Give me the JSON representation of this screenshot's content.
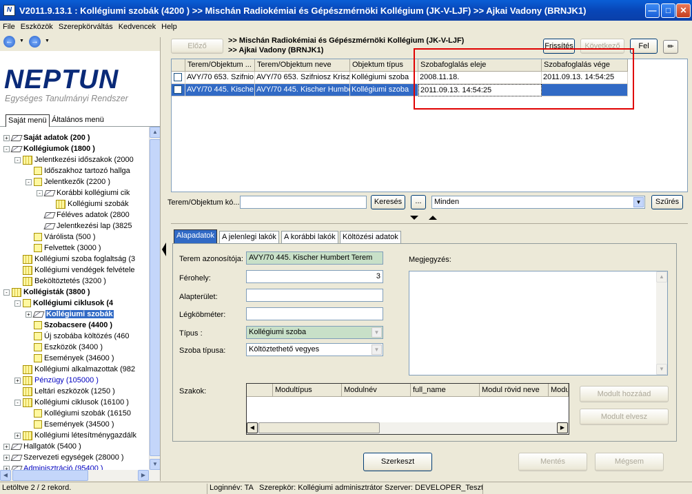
{
  "window": {
    "title": "V2011.9.13.1 : Kollégiumi szobák (4200  )  >> Mischán Radiokémiai és Gépészmérnöki Kollégium (JK-V-LJF) >> Ajkai Vadony (BRNJK1)",
    "app_icon": "N"
  },
  "menu": [
    "File",
    "Eszközök",
    "Szerepkörváltás",
    "Kedvencek",
    "Help"
  ],
  "logo": {
    "name": "NEPTUN",
    "subtitle": "Egységes Tanulmányi Rendszer"
  },
  "left_tabs": [
    "Saját menü",
    "Általános menü"
  ],
  "tree": [
    {
      "label": "Saját adatok (200  )",
      "icon": "diamond",
      "expander": "+",
      "bold": true
    },
    {
      "label": "Kollégiumok (1800  )",
      "icon": "diamond",
      "expander": "-",
      "bold": true
    },
    {
      "label": "Jelentkezési időszakok (2000",
      "icon": "multi",
      "expander": "-"
    },
    {
      "label": "Időszakhoz tartozó hallga",
      "icon": "folder"
    },
    {
      "label": "Jelentkezők (2200  )",
      "icon": "folder",
      "expander": "-"
    },
    {
      "label": "Korábbi kollégiumi cik",
      "icon": "diamond",
      "expander": "-"
    },
    {
      "label": "Kollégiumi szobák",
      "icon": "multi"
    },
    {
      "label": "Féléves adatok (2800",
      "icon": "diamond"
    },
    {
      "label": "Jelentkezési lap (3825",
      "icon": "diamond"
    },
    {
      "label": "Várólista (500  )",
      "icon": "folder"
    },
    {
      "label": "Felvettek (3000  )",
      "icon": "folder"
    },
    {
      "label": "Kollégiumi szoba foglaltság (3",
      "icon": "multi"
    },
    {
      "label": "Kollégiumi vendégek felvétele",
      "icon": "multi"
    },
    {
      "label": "Beköltöztetés (3200  )",
      "icon": "multi"
    },
    {
      "label": "Kollégisták (3800  )",
      "icon": "multi",
      "expander": "-",
      "bold": true
    },
    {
      "label": "Kollégiumi ciklusok (4",
      "icon": "folder",
      "expander": "-",
      "bold": true
    },
    {
      "label": "Kollégiumi szobák",
      "icon": "diamond",
      "expander": "+",
      "selected": true
    },
    {
      "label": "Szobacsere (4400  )",
      "icon": "folder",
      "bold": true
    },
    {
      "label": "Új szobába költözés (460",
      "icon": "folder"
    },
    {
      "label": "Eszközök (3400  )",
      "icon": "folder"
    },
    {
      "label": "Események (34600  )",
      "icon": "folder"
    },
    {
      "label": "Kollégiumi alkalmazottak (982",
      "icon": "multi"
    },
    {
      "label": "Pénzügy (105000  )",
      "icon": "multi",
      "expander": "+",
      "blue": true
    },
    {
      "label": "Leltári eszközök (1250  )",
      "icon": "multi"
    },
    {
      "label": "Kollégiumi ciklusok (16100  )",
      "icon": "multi",
      "expander": "-"
    },
    {
      "label": "Kollégiumi szobák (16150",
      "icon": "folder"
    },
    {
      "label": "Események (34500  )",
      "icon": "folder"
    },
    {
      "label": "Kollégiumi létesítménygazdálk",
      "icon": "multi",
      "expander": "+"
    },
    {
      "label": "Hallgatók (5400  )",
      "icon": "diamond",
      "expander": "+"
    },
    {
      "label": "Szervezeti egységek (28000  )",
      "icon": "diamond",
      "expander": "+"
    },
    {
      "label": "Adminisztráció (95400  )",
      "icon": "diamond",
      "expander": "+",
      "blue": true
    }
  ],
  "top": {
    "prev_button": "Előző",
    "crumb1": ">> Mischán Radiokémiai és Gépészmérnöki Kollégium (JK-V-LJF)",
    "crumb2": ">> Ajkai Vadony (BRNJK1)",
    "refresh_button": "Frissítés",
    "next_button": "Következő",
    "up_button": "Fel",
    "columns": [
      "Terem/Objektum ...",
      "Terem/Objektum neve",
      "Objektum típus",
      "Szobafoglalás eleje",
      "Szobafoglalás vége"
    ],
    "rows": [
      [
        "AVY/70 653. Szifnio",
        "AVY/70 653. Szifniosz Kriszti",
        "Kollégiumi szoba",
        "2008.11.18.",
        "2011.09.13. 14:54:25"
      ],
      [
        "AVY/70 445. Kische",
        "AVY/70 445. Kischer Humbe",
        "Kollégiumi szoba",
        "2011.09.13. 14:54:25",
        ""
      ]
    ],
    "search_label": "Terem/Objektum kó...",
    "search_value": "",
    "search_button": "Keresés",
    "dots_button": "...",
    "filter_value": "Minden",
    "filter_button": "Szűrés"
  },
  "tabs": [
    "Alapadatok",
    "A jelenlegi lakók",
    "A korábbi lakók",
    "Költözési adatok"
  ],
  "form": {
    "terem_label": "Terem azonosítója:",
    "terem_value": "AVY/70 445. Kischer Humbert Terem",
    "ferohely_label": "Férohely:",
    "ferohely_value": "3",
    "alapterulet_label": "Alapterület:",
    "legkobmeter_label": "Légköbméter:",
    "tipus_label": "Típus :",
    "tipus_value": "Kollégiumi szoba",
    "szobatipus_label": "Szoba típusa:",
    "szobatipus_value": "Költöztethető vegyes",
    "megjegyzes_label": "Megjegyzés:",
    "szakok_label": "Szakok:",
    "mod_columns": [
      "Modultípus",
      "Modulnév",
      "full_name",
      "Modul rövid neve",
      "Modu"
    ],
    "add_module_button": "Modult hozzáad",
    "remove_module_button": "Modult elvesz"
  },
  "actions": {
    "edit": "Szerkeszt",
    "save": "Mentés",
    "cancel": "Mégsem"
  },
  "status": {
    "records": "Letöltve 2 / 2 rekord.",
    "login": "Loginnév: TA",
    "role": "Szerepkör: Kollégiumi adminisztrátor",
    "server": "Szerver: DEVELOPER_Teszt"
  },
  "colors": {
    "title_bar": "#0846b8",
    "selection": "#316ac5",
    "highlight_box": "#e00000",
    "green_field": "#c8e0c8"
  }
}
